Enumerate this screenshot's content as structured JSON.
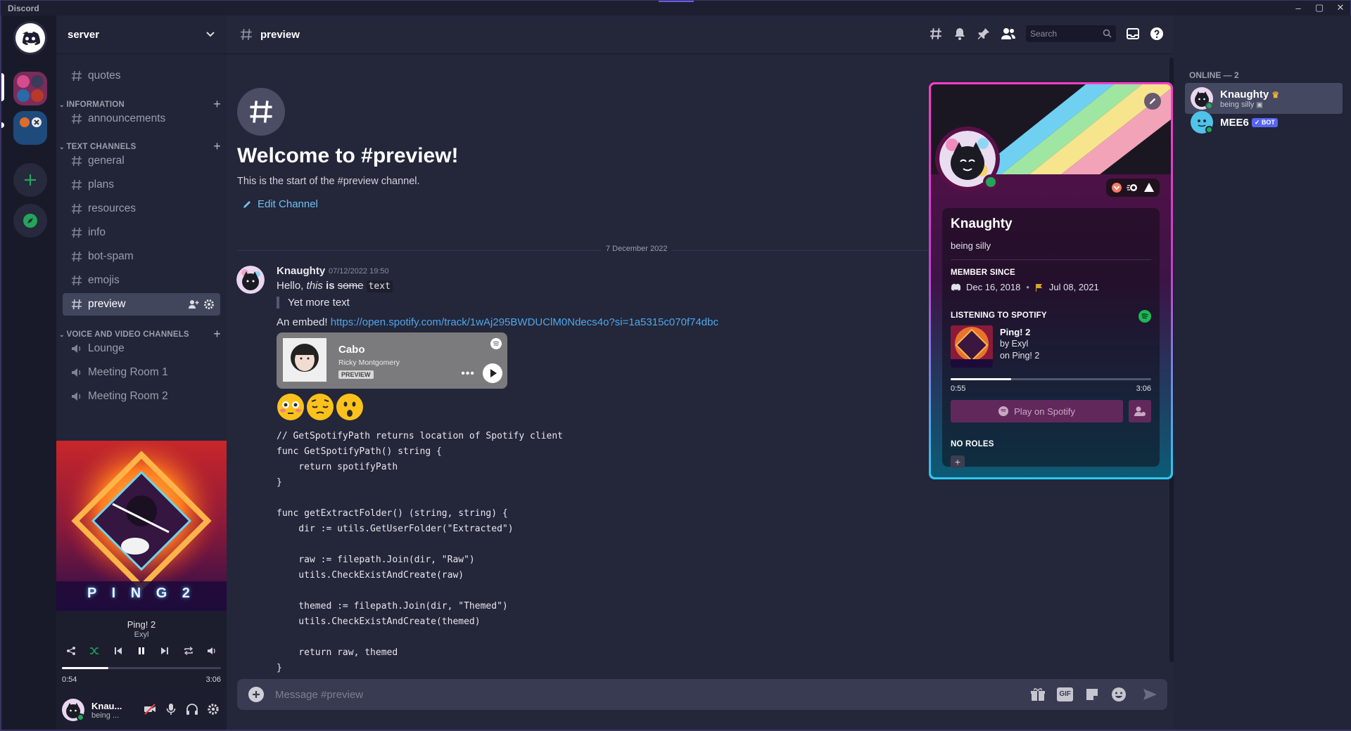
{
  "window": {
    "title": "Discord",
    "min": "–",
    "max": "▢",
    "close": "✕"
  },
  "server": {
    "name": "server"
  },
  "channels": {
    "top": [
      {
        "name": "quotes"
      }
    ],
    "categories": [
      {
        "label": "INFORMATION",
        "items": [
          {
            "name": "announcements"
          }
        ]
      },
      {
        "label": "TEXT CHANNELS",
        "items": [
          {
            "name": "general"
          },
          {
            "name": "plans"
          },
          {
            "name": "resources"
          },
          {
            "name": "info"
          },
          {
            "name": "bot-spam"
          },
          {
            "name": "emojis"
          },
          {
            "name": "preview",
            "active": true
          }
        ]
      },
      {
        "label": "VOICE AND VIDEO CHANNELS",
        "items": [
          {
            "name": "Lounge"
          },
          {
            "name": "Meeting Room 1"
          },
          {
            "name": "Meeting Room 2"
          }
        ]
      }
    ]
  },
  "player": {
    "track": "Ping! 2",
    "artist": "Exyl",
    "elapsed": "0:54",
    "duration": "3:06",
    "progress": 0.29,
    "art_text": "P I N G  2"
  },
  "user": {
    "name": "Knau...",
    "status": "being ..."
  },
  "header": {
    "channel": "preview",
    "search_placeholder": "Search"
  },
  "welcome": {
    "title": "Welcome to #preview!",
    "subtitle": "This is the start of the #preview channel.",
    "edit": "Edit Channel"
  },
  "divider_date": "7 December 2022",
  "message": {
    "author": "Knaughty",
    "timestamp": "07/12/2022 19:50",
    "line1": {
      "a": "Hello, ",
      "b": "this",
      "c": " is ",
      "d": "some",
      "e": "text"
    },
    "quote": "Yet more text",
    "embed_prefix": "An embed! ",
    "link": "https://open.spotify.com/track/1wAj295BWDUClM0Ndecs4o?si=1a5315c070f74dbc",
    "spotify_embed": {
      "title": "Cabo",
      "artist": "Ricky Montgomery",
      "badge": "PREVIEW"
    },
    "emojis": [
      "flushed",
      "pensive",
      "hushed"
    ],
    "code": "// GetSpotifyPath returns location of Spotify client\nfunc GetSpotifyPath() string {\n    return spotifyPath\n}\n\nfunc getExtractFolder() (string, string) {\n    dir := utils.GetUserFolder(\"Extracted\")\n\n    raw := filepath.Join(dir, \"Raw\")\n    utils.CheckExistAndCreate(raw)\n\n    themed := filepath.Join(dir, \"Themed\")\n    utils.CheckExistAndCreate(themed)\n\n    return raw, themed\n}"
  },
  "composer": {
    "placeholder": "Message #preview",
    "gif": "GIF"
  },
  "members": {
    "header": "ONLINE — 2",
    "list": [
      {
        "name": "Knaughty",
        "status": "being silly"
      },
      {
        "name": "MEE6",
        "badge": "BOT"
      }
    ]
  },
  "profile": {
    "name": "Knaughty",
    "status": "being silly",
    "member_since_label": "MEMBER SINCE",
    "discord_date": "Dec 16, 2018",
    "server_date": "Jul 08, 2021",
    "listening_label": "LISTENING TO SPOTIFY",
    "track": "Ping! 2",
    "by": "by Exyl",
    "on": "on Ping! 2",
    "elapsed": "0:55",
    "duration": "3:06",
    "progress": 0.3,
    "play_label": "Play on Spotify",
    "roles_label": "NO ROLES"
  },
  "colors": {
    "accent": "#5865f2",
    "online": "#23a55a",
    "link": "#4da8ea",
    "spotify": "#1db954"
  }
}
